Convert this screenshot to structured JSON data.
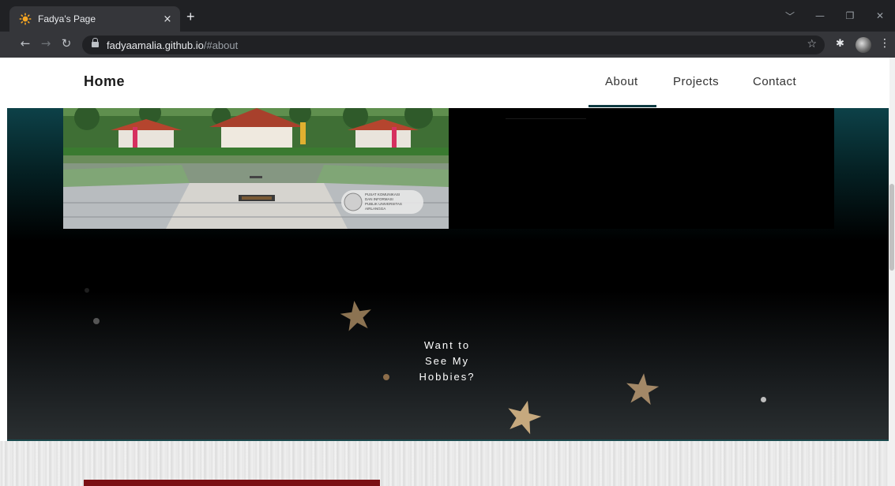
{
  "browser": {
    "tab_title": "Fadya's Page",
    "url_host": "fadyaamalia.github.io",
    "url_path": "/#about",
    "tab_close": "×",
    "new_tab": "+"
  },
  "site": {
    "brand": "Home",
    "nav": [
      {
        "label": "About",
        "active": true
      },
      {
        "label": "Projects",
        "active": false
      },
      {
        "label": "Contact",
        "active": false
      }
    ],
    "hobbies_cta": [
      "Want to",
      "See My",
      "Hobbies?"
    ],
    "photo_caption": [
      "PUSAT KOMUNIKASI",
      "DAN INFORMASI",
      "PUBLIK UNIVERSITAS",
      "AIRLANGGA"
    ]
  },
  "colors": {
    "accent": "#0e3b42",
    "star": "#b39670",
    "lower_card": "#7b0f14"
  },
  "icons": [
    "favicon-sun-icon",
    "back-icon",
    "forward-icon",
    "reload-icon",
    "lock-icon",
    "bookmark-star-icon",
    "extensions-icon",
    "profile-avatar",
    "menu-icon",
    "minimize-icon",
    "restore-icon",
    "close-icon",
    "tab-search-icon"
  ]
}
